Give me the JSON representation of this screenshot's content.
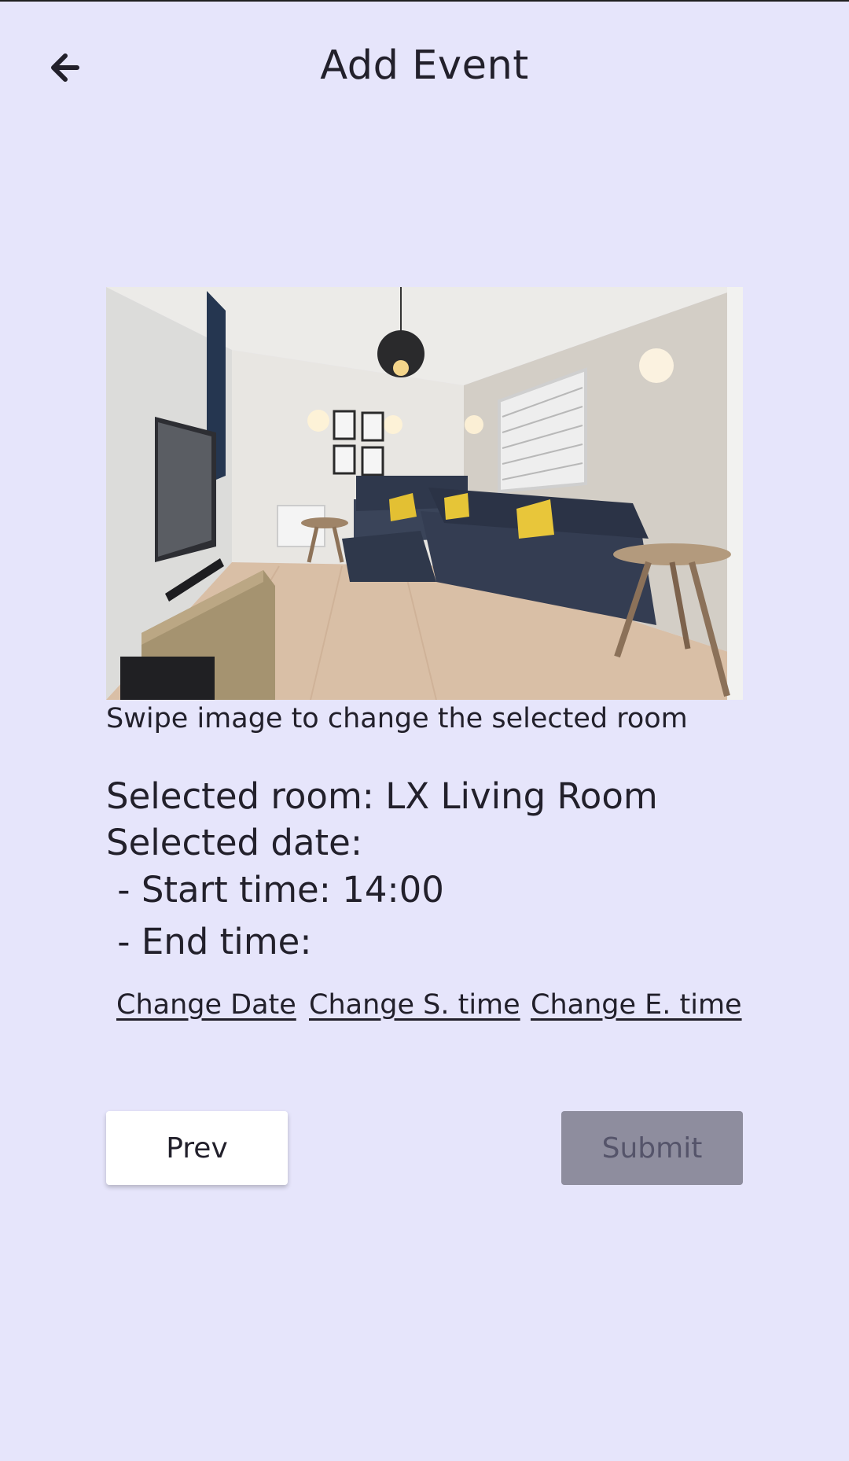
{
  "header": {
    "title": "Add Event",
    "back_icon": "arrow-left-icon"
  },
  "room_carousel": {
    "image_description_icon": "living-room-photo",
    "hint": "Swipe image to change the selected room"
  },
  "selection": {
    "room_line": "Selected room: LX Living Room",
    "date_line": "Selected date:",
    "start_line": " - Start time: 14:00",
    "end_line": " - End time:"
  },
  "actions": {
    "change_date": "Change Date",
    "change_start": "Change S. time",
    "change_end": "Change E. time"
  },
  "footer": {
    "prev_label": "Prev",
    "submit_label": "Submit"
  },
  "colors": {
    "background": "#e6e5fb",
    "submit_disabled": "#8e8d9e",
    "text": "#22202b"
  }
}
